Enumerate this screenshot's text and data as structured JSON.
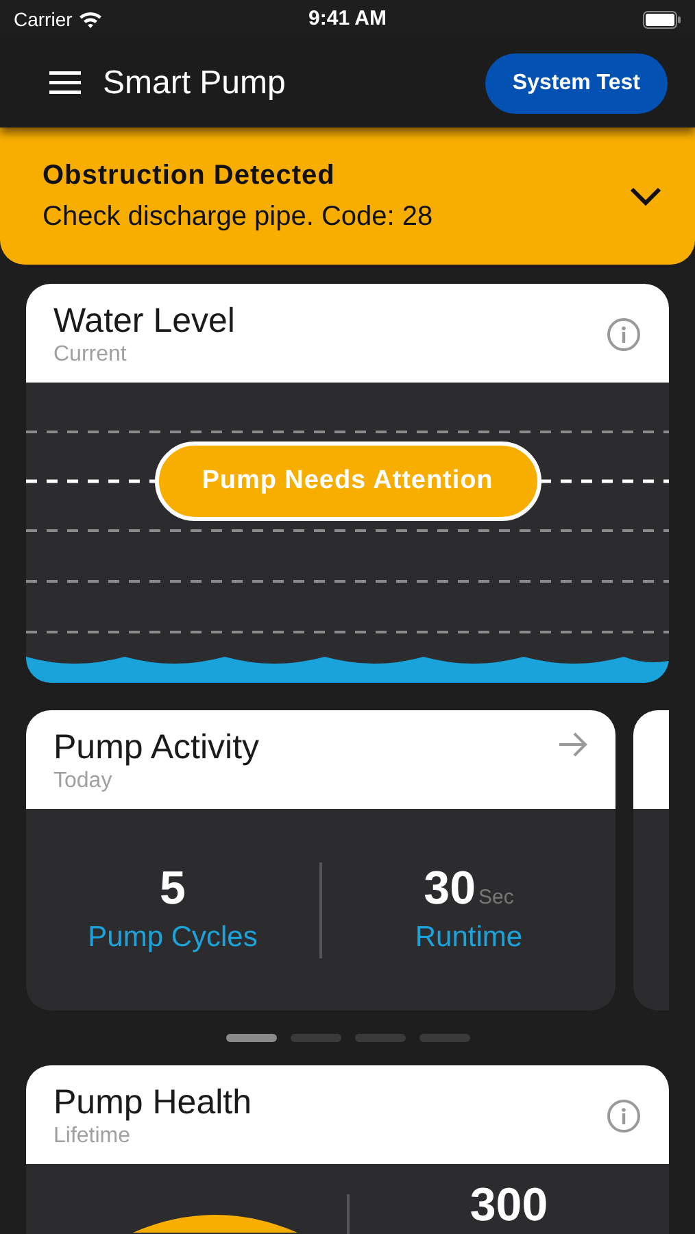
{
  "status_bar": {
    "carrier": "Carrier",
    "time": "9:41 AM"
  },
  "header": {
    "title": "Smart Pump",
    "button": "System Test"
  },
  "alert": {
    "title": "Obstruction Detected",
    "message": "Check discharge pipe. Code: 28",
    "expanded": false
  },
  "water_level": {
    "title": "Water Level",
    "subtitle": "Current",
    "status": "Pump Needs Attention"
  },
  "carousel": {
    "cards": [
      {
        "title": "Pump Activity",
        "subtitle": "Today",
        "stats": [
          {
            "value": "5",
            "label": "Pump Cycles"
          },
          {
            "value": "30",
            "unit": "Sec",
            "label": "Runtime"
          }
        ]
      }
    ],
    "pages": [
      {
        "selected": true
      },
      {
        "selected": false
      },
      {
        "selected": false
      },
      {
        "selected": false
      }
    ]
  },
  "pump_health": {
    "title": "Pump Health",
    "subtitle": "Lifetime",
    "stat_value": "300"
  }
}
